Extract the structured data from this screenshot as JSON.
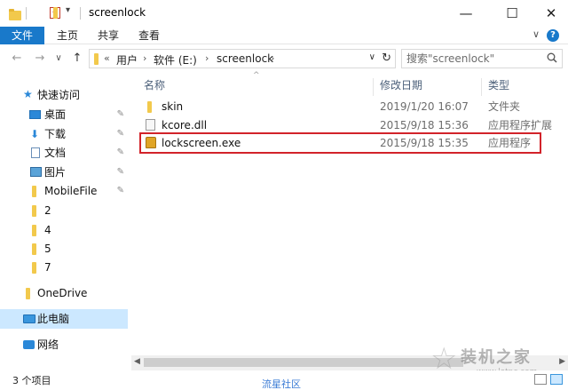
{
  "window": {
    "title": "screenlock",
    "minimize_label": "—",
    "maximize_label": "☐",
    "close_label": "✕"
  },
  "ribbon": {
    "tabs": [
      "文件",
      "主页",
      "共享",
      "查看"
    ],
    "active_tab_color": "#1979ca",
    "help_label": "?"
  },
  "address": {
    "back": "←",
    "forward": "→",
    "recent": "∨",
    "up": "↑",
    "overflow": "«",
    "crumbs": [
      "用户",
      "软件 (E:)",
      "screenlock"
    ],
    "search_placeholder": "搜索\"screenlock\""
  },
  "nav": {
    "items": [
      {
        "label": "快速访问",
        "icon": "star-icon"
      },
      {
        "label": "桌面",
        "icon": "desktop-icon",
        "pinned": true
      },
      {
        "label": "下载",
        "icon": "download-icon",
        "pinned": true
      },
      {
        "label": "文档",
        "icon": "document-icon",
        "pinned": true
      },
      {
        "label": "图片",
        "icon": "picture-icon",
        "pinned": true
      },
      {
        "label": "MobileFile",
        "icon": "folder-icon",
        "pinned": true
      },
      {
        "label": "2",
        "icon": "folder-icon"
      },
      {
        "label": "4",
        "icon": "folder-icon"
      },
      {
        "label": "5",
        "icon": "folder-icon"
      },
      {
        "label": "7",
        "icon": "folder-icon"
      },
      {
        "label": "OneDrive",
        "icon": "cloud-icon"
      },
      {
        "label": "此电脑",
        "icon": "computer-icon",
        "selected": true
      },
      {
        "label": "网络",
        "icon": "network-icon"
      }
    ],
    "pin_glyph": "📌"
  },
  "columns": {
    "name": "名称",
    "date": "修改日期",
    "type": "类型"
  },
  "files": [
    {
      "name": "skin",
      "date": "2019/1/20 16:07",
      "type": "文件夹",
      "icon": "folder-icon"
    },
    {
      "name": "kcore.dll",
      "date": "2015/9/18 15:36",
      "type": "应用程序扩展",
      "icon": "dll-file-icon"
    },
    {
      "name": "lockscreen.exe",
      "date": "2015/9/18 15:35",
      "type": "应用程序",
      "icon": "exe-file-icon",
      "highlighted": true
    }
  ],
  "status": {
    "item_count": "3 个项目"
  },
  "watermark": {
    "title": "装机之家",
    "url": "www.lotpc.com",
    "bottom_text": "流星社区"
  }
}
